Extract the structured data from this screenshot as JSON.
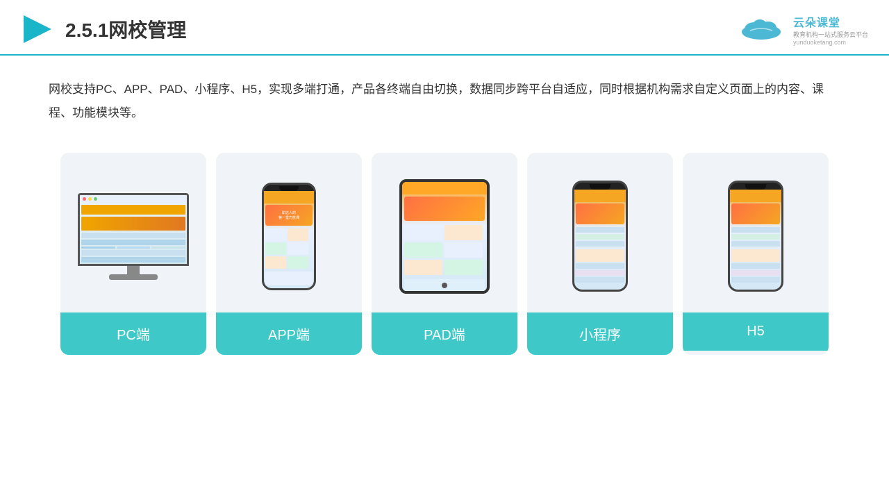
{
  "header": {
    "title": "2.5.1网校管理",
    "logo_name": "云朵课堂",
    "logo_url": "yunduoketang.com",
    "logo_tagline": "教育机构一站式服务云平台"
  },
  "description": {
    "text": "网校支持PC、APP、PAD、小程序、H5，实现多端打通，产品各终端自由切换，数据同步跨平台自适应，同时根据机构需求自定义页面上的内容、课程、功能模块等。"
  },
  "cards": [
    {
      "id": "pc",
      "label": "PC端"
    },
    {
      "id": "app",
      "label": "APP端"
    },
    {
      "id": "pad",
      "label": "PAD端"
    },
    {
      "id": "miniprogram",
      "label": "小程序"
    },
    {
      "id": "h5",
      "label": "H5"
    }
  ]
}
